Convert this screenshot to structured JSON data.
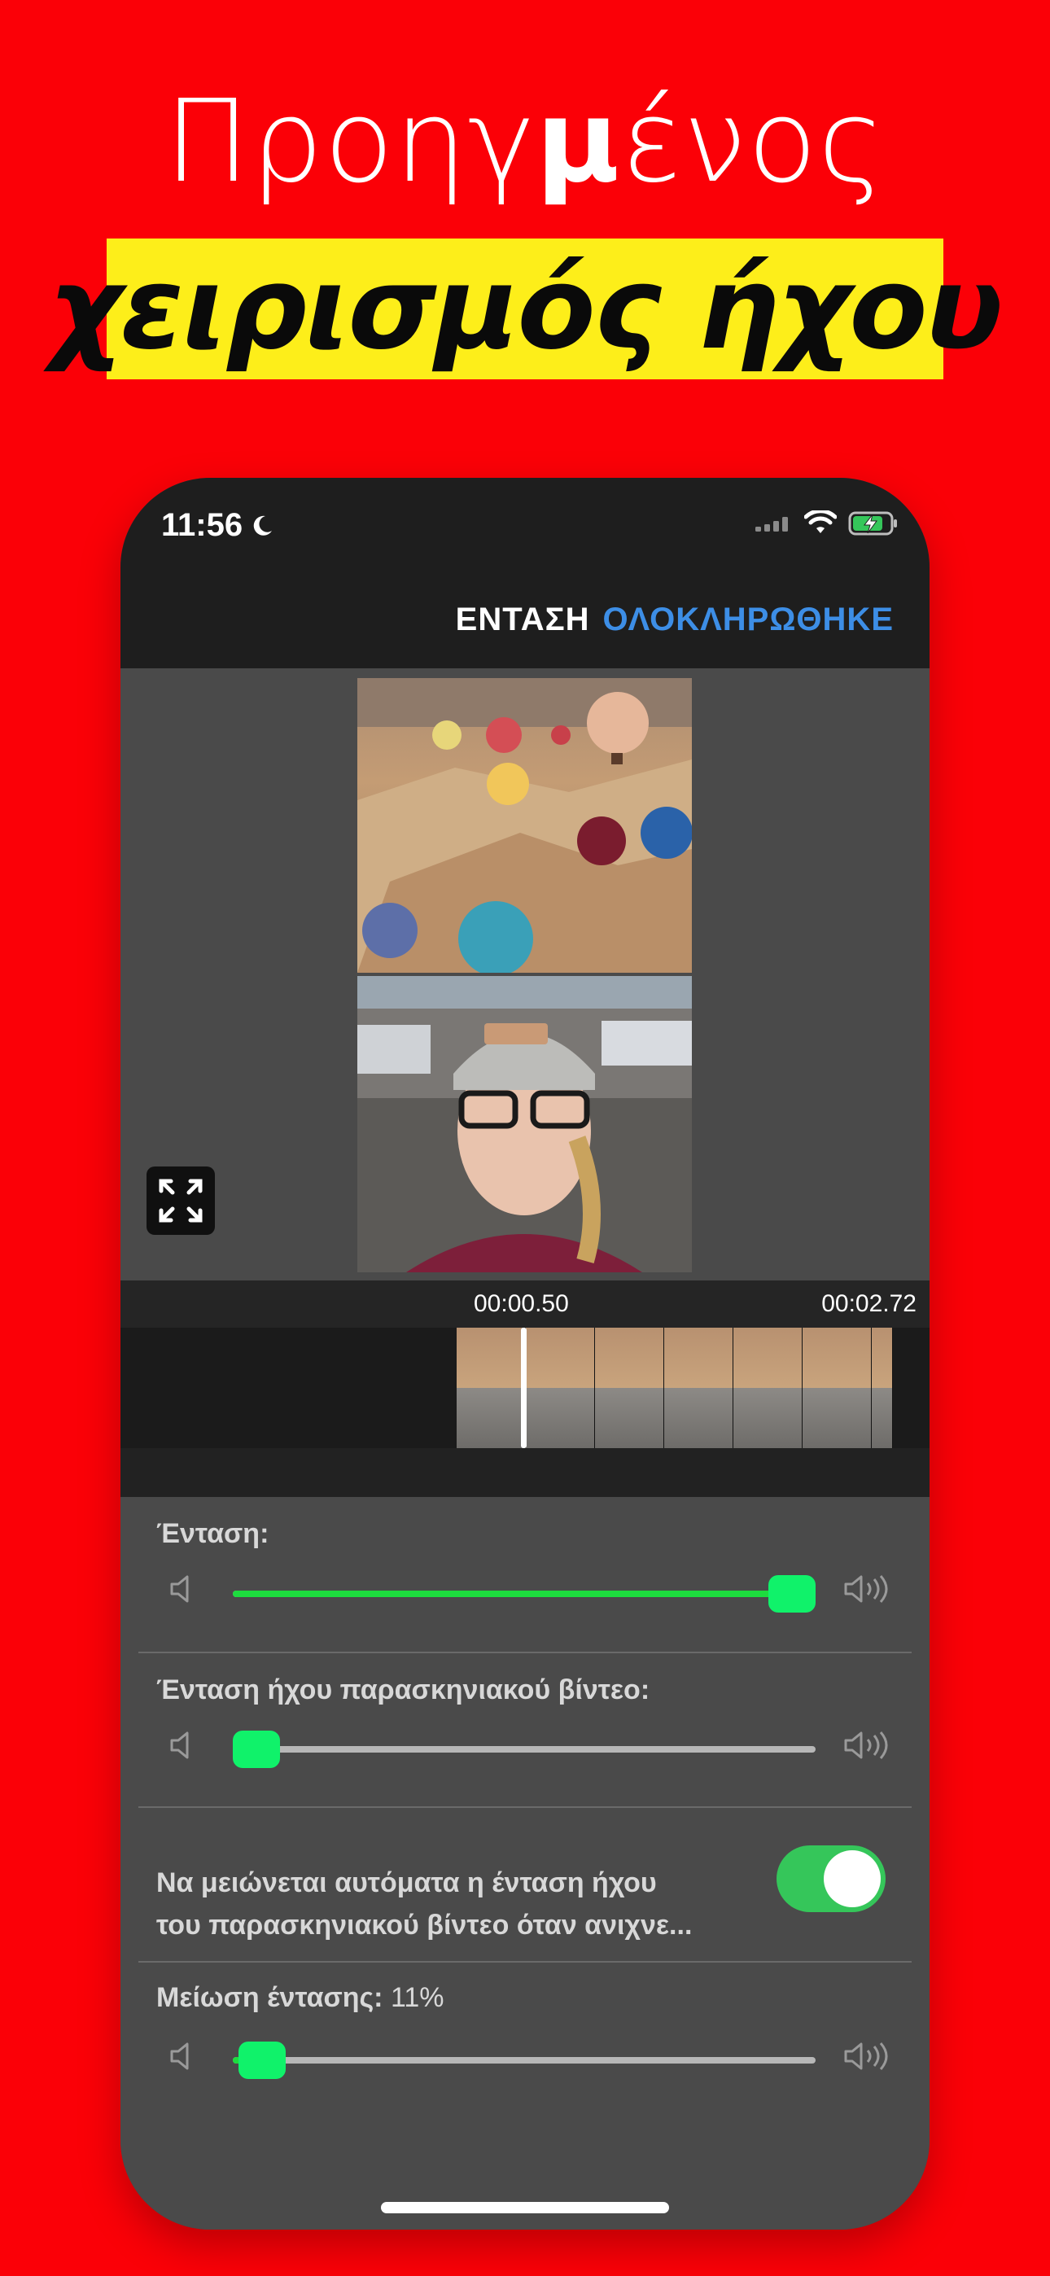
{
  "headline": {
    "line1_a": "Προηγ",
    "line1_b": "μ",
    "line1_c": "ένος",
    "line2": "χειρισμός ήχου"
  },
  "status_bar": {
    "time": "11:56",
    "icons": [
      "moon-icon",
      "signal-icon",
      "wifi-icon",
      "battery-charging-icon"
    ]
  },
  "nav": {
    "volume_label": "ΕΝΤΑΣΗ",
    "done_label": "ΟΛΟΚΛΗΡΩΘΗΚΕ"
  },
  "preview": {
    "expand_icon": "expand-icon"
  },
  "timeline": {
    "current_time": "00:00.50",
    "total_time": "00:02.72",
    "frames": 7
  },
  "controls": {
    "volume": {
      "label": "Ένταση:",
      "value_fraction": 0.96
    },
    "bg_volume": {
      "label": "Ένταση ήχου παρασκηνιακού βίντεο:",
      "value_fraction": 0.04
    },
    "auto_duck": {
      "line1": "Να μειώνεται αυτόματα η ένταση ήχου",
      "line2": "του παρασκηνιακού βίντεο όταν ανιχνε...",
      "enabled": true
    },
    "reduction": {
      "label": "Μείωση έντασης:",
      "value_text": "11%",
      "value_fraction": 0.05
    }
  },
  "colors": {
    "background": "#fb0007",
    "banner": "#fdee1a",
    "accent_blue": "#3d8ee6",
    "slider_green": "#1ddc3e",
    "toggle_green": "#35c65a"
  }
}
